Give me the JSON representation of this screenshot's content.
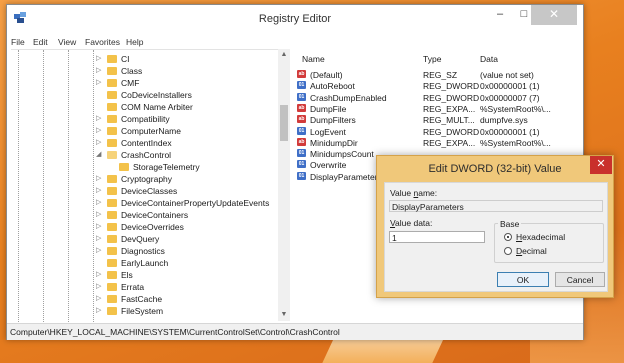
{
  "window": {
    "title": "Registry Editor",
    "controls": {
      "minimize": "–",
      "maximize": "□",
      "close": "✕"
    }
  },
  "menu": [
    "File",
    "Edit",
    "View",
    "Favorites",
    "Help"
  ],
  "tree": {
    "items": [
      {
        "label": "CI",
        "expander": "▷",
        "indent": 0,
        "open": false
      },
      {
        "label": "Class",
        "expander": "▷",
        "indent": 0,
        "open": false
      },
      {
        "label": "CMF",
        "expander": "▷",
        "indent": 0,
        "open": false
      },
      {
        "label": "CoDeviceInstallers",
        "expander": "",
        "indent": 0,
        "open": false
      },
      {
        "label": "COM Name Arbiter",
        "expander": "",
        "indent": 0,
        "open": false
      },
      {
        "label": "Compatibility",
        "expander": "▷",
        "indent": 0,
        "open": false
      },
      {
        "label": "ComputerName",
        "expander": "▷",
        "indent": 0,
        "open": false
      },
      {
        "label": "ContentIndex",
        "expander": "▷",
        "indent": 0,
        "open": false
      },
      {
        "label": "CrashControl",
        "expander": "◢",
        "indent": 0,
        "open": true
      },
      {
        "label": "StorageTelemetry",
        "expander": "",
        "indent": 1,
        "open": false
      },
      {
        "label": "Cryptography",
        "expander": "▷",
        "indent": 0,
        "open": false
      },
      {
        "label": "DeviceClasses",
        "expander": "▷",
        "indent": 0,
        "open": false
      },
      {
        "label": "DeviceContainerPropertyUpdateEvents",
        "expander": "▷",
        "indent": 0,
        "open": false
      },
      {
        "label": "DeviceContainers",
        "expander": "▷",
        "indent": 0,
        "open": false
      },
      {
        "label": "DeviceOverrides",
        "expander": "▷",
        "indent": 0,
        "open": false
      },
      {
        "label": "DevQuery",
        "expander": "▷",
        "indent": 0,
        "open": false
      },
      {
        "label": "Diagnostics",
        "expander": "▷",
        "indent": 0,
        "open": false
      },
      {
        "label": "EarlyLaunch",
        "expander": "",
        "indent": 0,
        "open": false
      },
      {
        "label": "Els",
        "expander": "▷",
        "indent": 0,
        "open": false
      },
      {
        "label": "Errata",
        "expander": "▷",
        "indent": 0,
        "open": false
      },
      {
        "label": "FastCache",
        "expander": "▷",
        "indent": 0,
        "open": false
      },
      {
        "label": "FileSystem",
        "expander": "▷",
        "indent": 0,
        "open": false
      }
    ]
  },
  "list": {
    "columns": [
      "Name",
      "Type",
      "Data"
    ],
    "rows": [
      {
        "icon": "sz",
        "name": "(Default)",
        "type": "REG_SZ",
        "data": "(value not set)"
      },
      {
        "icon": "bin",
        "name": "AutoReboot",
        "type": "REG_DWORD",
        "data": "0x00000001 (1)"
      },
      {
        "icon": "bin",
        "name": "CrashDumpEnabled",
        "type": "REG_DWORD",
        "data": "0x00000007 (7)"
      },
      {
        "icon": "sz",
        "name": "DumpFile",
        "type": "REG_EXPA...",
        "data": "%SystemRoot%\\..."
      },
      {
        "icon": "sz",
        "name": "DumpFilters",
        "type": "REG_MULT...",
        "data": "dumpfve.sys"
      },
      {
        "icon": "bin",
        "name": "LogEvent",
        "type": "REG_DWORD",
        "data": "0x00000001 (1)"
      },
      {
        "icon": "sz",
        "name": "MinidumpDir",
        "type": "REG_EXPA...",
        "data": "%SystemRoot%\\..."
      },
      {
        "icon": "bin",
        "name": "MinidumpsCount",
        "type": "",
        "data": ""
      },
      {
        "icon": "bin",
        "name": "Overwrite",
        "type": "",
        "data": ""
      },
      {
        "icon": "bin",
        "name": "DisplayParameters",
        "type": "",
        "data": ""
      }
    ]
  },
  "status": {
    "path": "Computer\\HKEY_LOCAL_MACHINE\\SYSTEM\\CurrentControlSet\\Control\\CrashControl"
  },
  "dialog": {
    "title": "Edit DWORD (32-bit) Value",
    "close": "✕",
    "value_name_label_pre": "Value ",
    "value_name_label_u": "n",
    "value_name_label_post": "ame:",
    "value_name": "DisplayParameters",
    "value_data_label_u": "V",
    "value_data_label_post": "alue data:",
    "value_data": "1",
    "base_label": "Base",
    "hex_u": "H",
    "hex_rest": "exadecimal",
    "dec_u": "D",
    "dec_rest": "ecimal",
    "base_selected": "hexadecimal",
    "ok": "OK",
    "cancel": "Cancel"
  }
}
